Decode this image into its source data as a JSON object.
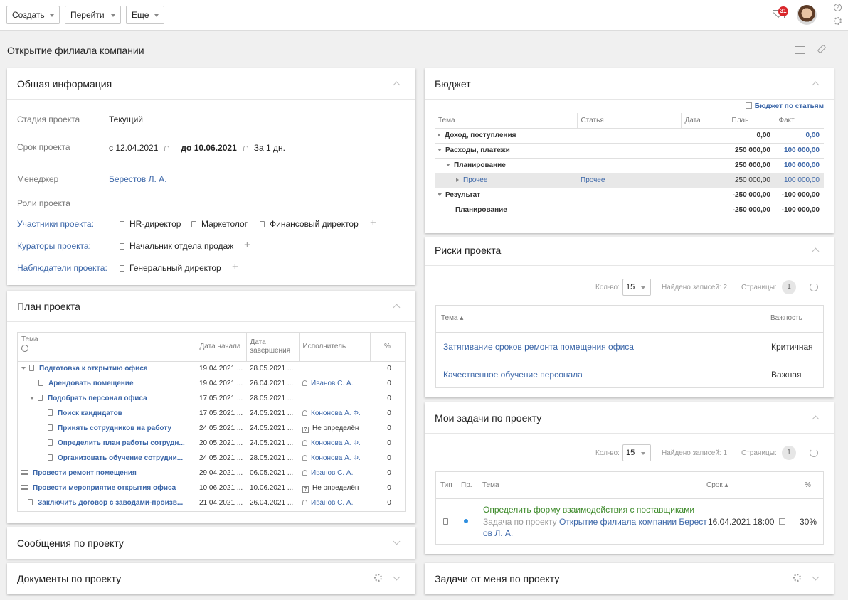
{
  "toolbar": {
    "create": "Создать",
    "goto": "Перейти",
    "more": "Еще",
    "notifications": "31",
    "help": "?"
  },
  "page_title": "Открытие филиала компании",
  "general": {
    "title": "Общая информация",
    "stage_label": "Стадия проекта",
    "stage_value": "Текущий",
    "period_label": "Срок проекта",
    "period_from": "с 12.04.2021",
    "period_to": "до 10.06.2021",
    "remind": "За 1 дн.",
    "manager_label": "Менеджер",
    "manager_value": "Берестов Л. А.",
    "roles_label": "Роли проекта",
    "participants_label": "Участники проекта:",
    "participants": [
      "HR-директор",
      "Маркетолог",
      "Финансовый директор"
    ],
    "curators_label": "Кураторы проекта:",
    "curators": [
      "Начальник отдела продаж"
    ],
    "observers_label": "Наблюдатели проекта:",
    "observers": [
      "Генеральный директор"
    ]
  },
  "plan": {
    "title": "План проекта",
    "cols": {
      "topic": "Тема",
      "start": "Дата начала",
      "end": "Дата завершения",
      "executor": "Исполнитель",
      "pct": "%"
    },
    "rows": [
      {
        "name": "Подготовка к открытию офиса",
        "start": "19.04.2021 ...",
        "end": "28.05.2021 ...",
        "exec": "",
        "pct": "0"
      },
      {
        "name": "Арендовать помещение",
        "start": "19.04.2021 ...",
        "end": "26.04.2021 ...",
        "exec": "Иванов С. А.",
        "pct": "0"
      },
      {
        "name": "Подобрать персонал офиса",
        "start": "17.05.2021 ...",
        "end": "28.05.2021 ...",
        "exec": "",
        "pct": "0"
      },
      {
        "name": "Поиск кандидатов",
        "start": "17.05.2021 ...",
        "end": "24.05.2021 ...",
        "exec": "Кононова А. Ф.",
        "pct": "0"
      },
      {
        "name": "Принять сотрудников на работу",
        "start": "24.05.2021 ...",
        "end": "24.05.2021 ...",
        "exec": "Не определён",
        "pct": "0"
      },
      {
        "name": "Определить план работы сотрудн...",
        "start": "20.05.2021 ...",
        "end": "24.05.2021 ...",
        "exec": "Кононова А. Ф.",
        "pct": "0"
      },
      {
        "name": "Организовать обучение сотрудни...",
        "start": "24.05.2021 ...",
        "end": "28.05.2021 ...",
        "exec": "Кононова А. Ф.",
        "pct": "0"
      },
      {
        "name": "Провести ремонт помещения",
        "start": "29.04.2021 ...",
        "end": "06.05.2021 ...",
        "exec": "Иванов С. А.",
        "pct": "0"
      },
      {
        "name": "Провести мероприятие открытия офиса",
        "start": "10.06.2021 ...",
        "end": "10.06.2021 ...",
        "exec": "Не определён",
        "pct": "0"
      },
      {
        "name": "Заключить договор с заводами-произв...",
        "start": "21.04.2021 ...",
        "end": "26.04.2021 ...",
        "exec": "Иванов С. А.",
        "pct": "0"
      }
    ]
  },
  "messages": {
    "title": "Сообщения по проекту"
  },
  "documents": {
    "title": "Документы по проекту"
  },
  "budget": {
    "title": "Бюджет",
    "by_items": "Бюджет по статьям",
    "cols": {
      "topic": "Тема",
      "item": "Статья",
      "date": "Дата",
      "plan": "План",
      "fact": "Факт"
    },
    "rows": [
      {
        "topic": "Доход, поступления",
        "item": "",
        "plan": "0,00",
        "fact": "0,00"
      },
      {
        "topic": "Расходы, платежи",
        "item": "",
        "plan": "250 000,00",
        "fact": "100 000,00"
      },
      {
        "topic": "Планирование",
        "item": "",
        "plan": "250 000,00",
        "fact": "100 000,00"
      },
      {
        "topic": "Прочее",
        "item": "Прочее",
        "plan": "250 000,00",
        "fact": "100 000,00"
      },
      {
        "topic": "Результат",
        "item": "",
        "plan": "-250 000,00",
        "fact": "-100 000,00"
      },
      {
        "topic": "Планирование",
        "item": "",
        "plan": "-250 000,00",
        "fact": "-100 000,00"
      }
    ]
  },
  "risks": {
    "title": "Риски проекта",
    "count_label": "Кол-во:",
    "count": "15",
    "found": "Найдено записей: 2",
    "pages_label": "Страницы:",
    "page": "1",
    "col_topic": "Тема",
    "col_importance": "Важность",
    "rows": [
      {
        "topic": "Затягивание сроков ремонта помещения офиса",
        "importance": "Критичная"
      },
      {
        "topic": "Качественное обучение персонала",
        "importance": "Важная"
      }
    ]
  },
  "mytasks": {
    "title": "Мои задачи по проекту",
    "count_label": "Кол-во:",
    "count": "15",
    "found": "Найдено записей: 1",
    "pages_label": "Страницы:",
    "page": "1",
    "col_type": "Тип",
    "col_pr": "Пр.",
    "col_topic": "Тема",
    "col_due": "Срок",
    "col_pct": "%",
    "task_name": "Определить форму взаимодействия с поставщиками",
    "task_prefix": "Задача по проекту",
    "task_project": "Открытие филиала компании Берест",
    "task_project2": "ов Л. А.",
    "task_due": "16.04.2021 18:00",
    "task_pct": "30%"
  },
  "tasks_from_me": {
    "title": "Задачи от меня по проекту"
  }
}
